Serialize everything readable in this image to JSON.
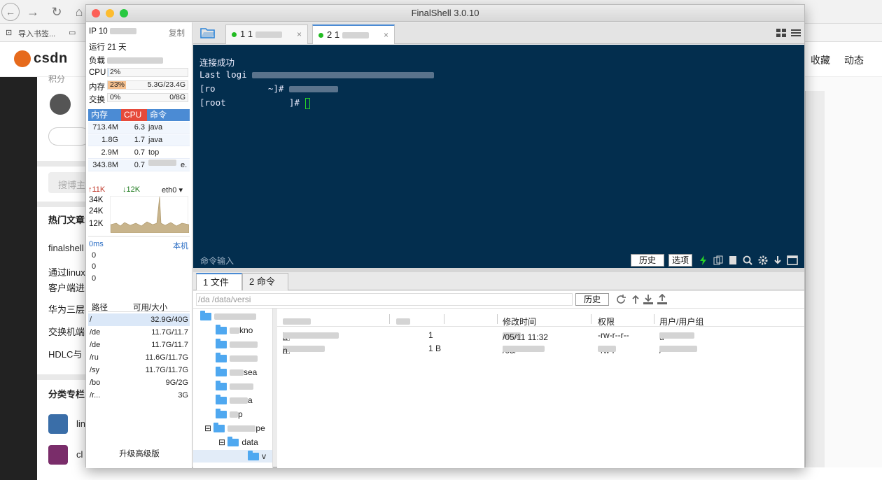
{
  "window": {
    "title": "FinalShell 3.0.10"
  },
  "browser_bg": {
    "bookmark1": "导入书签...",
    "csdn_logo": "csdn",
    "nav": [
      "收藏",
      "动态"
    ],
    "sidebar": {
      "label1": "积分",
      "search_placeholder": "搜博主",
      "hot_heading": "热门文章",
      "hot_items": [
        "finalshell",
        "通过linux",
        "客户端进",
        "华为三层",
        "交换机端",
        "HDLC与"
      ],
      "cat_heading": "分类专栏",
      "cat_items": [
        "lin",
        "cl"
      ]
    }
  },
  "monitor": {
    "ip_label": "IP 10",
    "copy": "复制",
    "uptime": "运行 21 天",
    "load_label": "负载",
    "cpu_label": "CPU",
    "cpu_value": "2%",
    "cpu_pct": 2,
    "mem_label": "内存",
    "mem_pct_text": "23%",
    "mem_pct": 23,
    "mem_value": "5.3G/23.4G",
    "swap_label": "交换",
    "swap_pct_text": "0%",
    "swap_value": "0/8G",
    "proc_headers": [
      "内存",
      "CPU",
      "命令"
    ],
    "processes": [
      {
        "mem": "713.4M",
        "cpu": "6.3",
        "cmd": "java"
      },
      {
        "mem": "1.8G",
        "cpu": "1.7",
        "cmd": "java"
      },
      {
        "mem": "2.9M",
        "cpu": "0.7",
        "cmd": "top"
      },
      {
        "mem": "343.8M",
        "cpu": "0.7",
        "cmd": "e."
      }
    ],
    "net_up": "11K",
    "net_down": "12K",
    "net_iface": "eth0",
    "net_scale": [
      "34K",
      "24K",
      "12K"
    ],
    "latency": "0ms",
    "latency_target": "本机",
    "latency_values": [
      "0",
      "0",
      "0"
    ],
    "disk_headers": [
      "路径",
      "可用/大小"
    ],
    "disks": [
      {
        "path": "/",
        "size": "32.9G/40G"
      },
      {
        "path": "/de",
        "size": "11.7G/11.7"
      },
      {
        "path": "/de",
        "size": "11.7G/11.7"
      },
      {
        "path": "/ru",
        "size": "11.6G/11.7G"
      },
      {
        "path": "/sy",
        "size": "11.7G/11.7G"
      },
      {
        "path": "/bo",
        "size": "9G/2G"
      },
      {
        "path": "/r...",
        "size": "3G"
      }
    ],
    "upgrade": "升级高级版"
  },
  "tabs": [
    {
      "label": "1 1",
      "close": "×"
    },
    {
      "label": "2 1",
      "close": "×"
    }
  ],
  "terminal": {
    "lines": [
      "连接成功",
      "Last logi",
      "[ro          ~]#",
      "[root            ]#"
    ],
    "cmd_label": "命令输入",
    "history_btn": "历史",
    "options_btn": "选项"
  },
  "filepanel": {
    "tabs": [
      "1 文件",
      "2 命令"
    ],
    "path": "/da                          /data/versi",
    "history_btn": "历史",
    "tree": [
      "kno",
      "sea",
      "a",
      "p",
      "pe",
      "data",
      "v"
    ],
    "headers": [
      "修改时间",
      "权限",
      "用户/用户组"
    ],
    "rows": [
      {
        "name": "a",
        "size": "1",
        "mtime": "/05/11 11:32",
        "perm": "-rw-r--r--",
        "owner": "u"
      },
      {
        "name": "n",
        "size": "1 B",
        "mtime": "/05/",
        "perm": "-rw-r",
        "owner": "/"
      }
    ]
  }
}
